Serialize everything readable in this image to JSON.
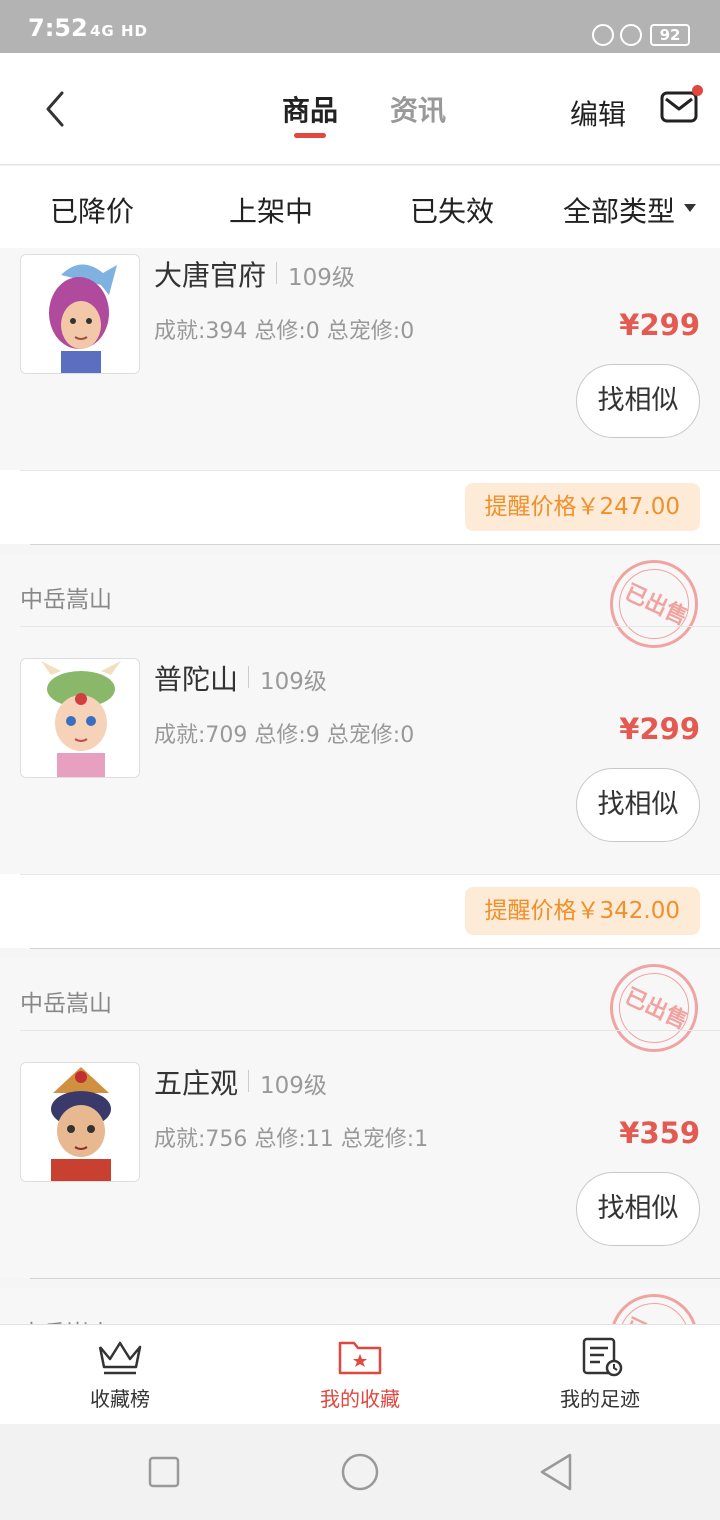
{
  "status_bar": {
    "time": "7:52",
    "network": "4G HD",
    "battery": "92"
  },
  "header": {
    "tabs": [
      {
        "label": "商品",
        "active": true
      },
      {
        "label": "资讯",
        "active": false
      }
    ],
    "edit_label": "编辑",
    "accent_color": "#e0473f"
  },
  "filters": [
    "已降价",
    "上架中",
    "已失效",
    "全部类型"
  ],
  "items": [
    {
      "server": "",
      "name": "大唐官府",
      "level": "109级",
      "stats": "成就:394 总修:0 总宠修:0",
      "price": "¥299",
      "similar_label": "找相似",
      "remind": "提醒价格￥247.00",
      "sold_stamp": ""
    },
    {
      "server": "中岳嵩山",
      "name": "普陀山",
      "level": "109级",
      "stats": "成就:709 总修:9 总宠修:0",
      "price": "¥299",
      "similar_label": "找相似",
      "remind": "提醒价格￥342.00",
      "sold_stamp": "已出售"
    },
    {
      "server": "中岳嵩山",
      "name": "五庄观",
      "level": "109级",
      "stats": "成就:756 总修:11 总宠修:1",
      "price": "¥359",
      "similar_label": "找相似",
      "remind": "",
      "sold_stamp": "已出售"
    },
    {
      "server": "中岳嵩山",
      "sold_stamp": "已出售"
    }
  ],
  "bottom_nav": [
    {
      "label": "收藏榜",
      "icon": "crown-icon",
      "active": false
    },
    {
      "label": "我的收藏",
      "icon": "folder-star-icon",
      "active": true
    },
    {
      "label": "我的足迹",
      "icon": "history-icon",
      "active": false
    }
  ]
}
